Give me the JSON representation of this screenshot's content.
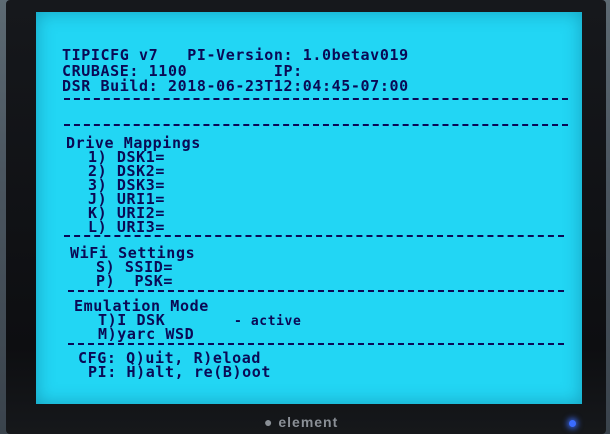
{
  "header": {
    "title_line": "TIPICFG v7   PI-Version: 1.0betav019",
    "crubase_line": "CRUBASE: 1100         IP:",
    "dsr_line": "DSR Build: 2018-06-23T12:04:45-07:00"
  },
  "drive_mappings": {
    "heading": "Drive Mappings",
    "items": [
      {
        "label": "1) DSK1="
      },
      {
        "label": "2) DSK2="
      },
      {
        "label": "3) DSK3="
      },
      {
        "label": "J) URI1="
      },
      {
        "label": "K) URI2="
      },
      {
        "label": "L) URI3="
      }
    ]
  },
  "wifi": {
    "heading": "WiFi Settings",
    "items": [
      {
        "label": "S) SSID="
      },
      {
        "label": "P)  PSK="
      }
    ]
  },
  "emulation": {
    "heading": "Emulation Mode",
    "items": [
      {
        "label": "T)I DSK",
        "status": "- active"
      },
      {
        "label": "M)yarc WSD",
        "status": ""
      }
    ]
  },
  "footer": {
    "cfg_line": "CFG: Q)uit, R)eload",
    "pi_line": "PI: H)alt, re(B)oot"
  },
  "monitor": {
    "brand": "element"
  },
  "colors": {
    "screen": "#22d6f4",
    "text": "#0a0a55",
    "bezel": "#0d0e11",
    "power_led": "#3a6bff"
  }
}
